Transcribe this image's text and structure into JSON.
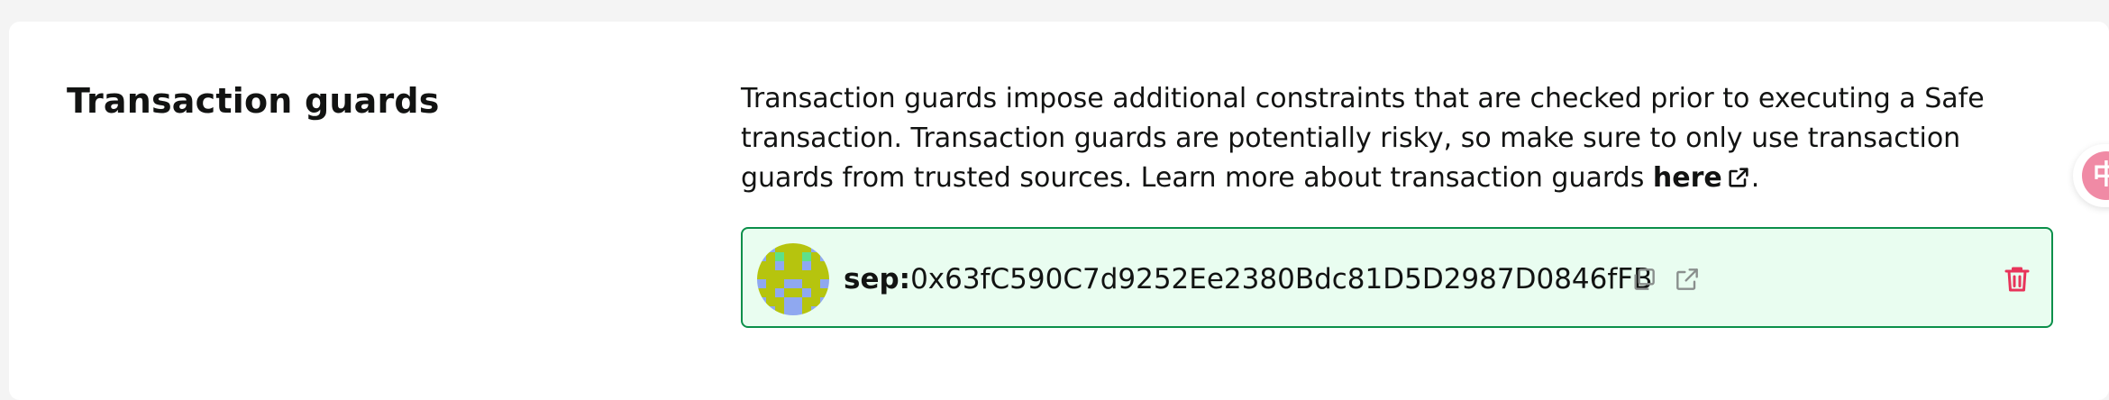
{
  "section": {
    "title": "Transaction guards",
    "description_prefix": "Transaction guards impose additional constraints that are checked prior to executing a Safe transaction. Transaction guards are potentially risky, so make sure to only use transaction guards from trusted sources. Learn more about transaction guards ",
    "link_text": "here",
    "description_suffix": "."
  },
  "guard": {
    "chain_prefix": "sep:",
    "address": "0x63fC590C7d9252Ee2380Bdc81D5D2987D0846fFB",
    "icons": {
      "copy": "copy-icon",
      "explorer": "external-link-icon",
      "delete": "trash-icon"
    },
    "colors": {
      "border": "#0b8f4a",
      "background": "#e9fdf0",
      "delete": "#e8345a"
    }
  },
  "side_widget": {
    "glyph": "中"
  }
}
